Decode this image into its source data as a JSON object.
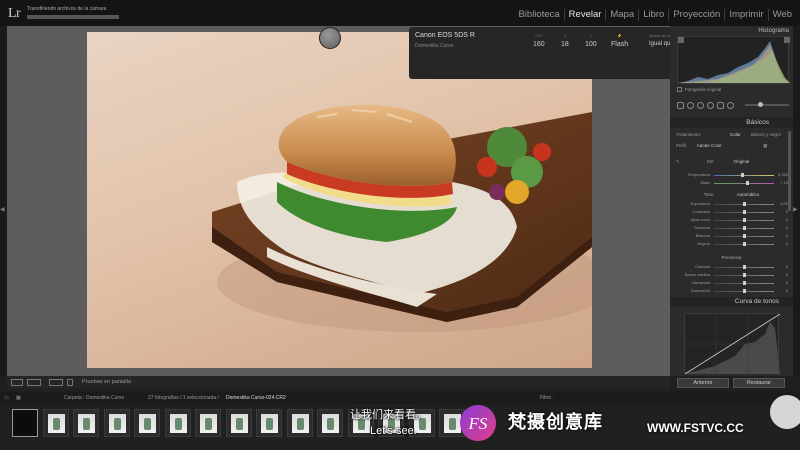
{
  "app": {
    "logo": "Lr",
    "status_text": "Transfiriendo archivos de la cámara",
    "modules": [
      "Biblioteca",
      "Revelar",
      "Mapa",
      "Libro",
      "Proyección",
      "Imprimir",
      "Web"
    ],
    "active_module": "Revelar"
  },
  "photo_info": {
    "camera": "Canon EOS 5DS R",
    "file": "Domestika Curso",
    "iso": "160",
    "aperture": "18",
    "shutter": "100",
    "flash": "Flash",
    "preset_label": "Ajuste de revelado",
    "preset_value": "Igual que los ant...",
    "close": "×"
  },
  "right_panel": {
    "histogram_title": "Histograma",
    "original_photo": "Fotografía original",
    "basic_title": "Básicos",
    "treatment_label": "Tratamiento:",
    "treatment_color": "Color",
    "treatment_bw": "Blanco y negro",
    "profile_label": "Perfil:",
    "profile_value": "Adobe Color",
    "wb_label": "EB:",
    "wb_value": "Original",
    "temp_label": "Temperatura",
    "temp_value": "6.250",
    "tint_label": "Matiz",
    "tint_value": "+ 10",
    "tone_label": "Tono",
    "tone_auto": "Automático",
    "adjustments": [
      {
        "name": "Exposición",
        "value": "0,00",
        "pos": 0.5
      },
      {
        "name": "Contraste",
        "value": "0",
        "pos": 0.5
      },
      {
        "name": "Altas luces",
        "value": "0",
        "pos": 0.5
      },
      {
        "name": "Sombras",
        "value": "0",
        "pos": 0.5
      },
      {
        "name": "Blancos",
        "value": "0",
        "pos": 0.5
      },
      {
        "name": "Negros",
        "value": "0",
        "pos": 0.5
      }
    ],
    "presence_label": "Presencia",
    "presence": [
      {
        "name": "Claridad",
        "value": "0",
        "pos": 0.5
      },
      {
        "name": "Borrar neblina",
        "value": "0",
        "pos": 0.5
      },
      {
        "name": "Intensidad",
        "value": "0",
        "pos": 0.5
      },
      {
        "name": "Saturación",
        "value": "0",
        "pos": 0.5
      }
    ],
    "tone_curve_title": "Curva de tonos",
    "prev_button": "Anterior",
    "reset_button": "Restaurar"
  },
  "toolbar": {
    "proof_label": "Pruebas en pantalla"
  },
  "film_bar": {
    "folder": "Carpeta : Domestika Curso",
    "count": "27 fotografías / 1 seleccionada /",
    "file": "Domestika Curso-024.CR2",
    "filter_label": "Filtro :"
  },
  "subtitles": {
    "cn": "让我们来看看。",
    "en": "Let's see."
  },
  "watermark": {
    "text": "梵摄创意库",
    "url": "WWW.FSTVC.CC",
    "logo_letters": "FS"
  },
  "colors": {
    "accent": "#e6e6e6",
    "watermark_pink": "#e0408a",
    "watermark_purple": "#8a3ad6"
  }
}
